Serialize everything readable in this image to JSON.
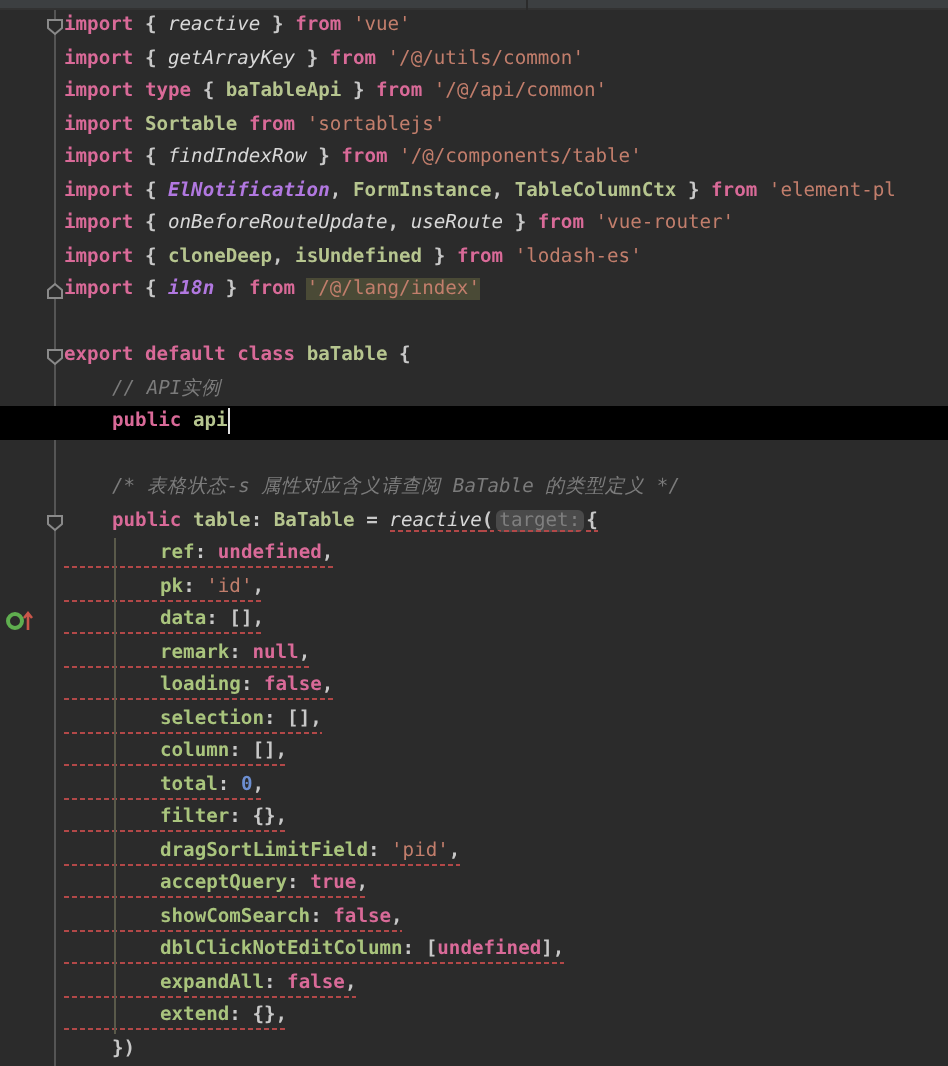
{
  "editor": {
    "lines": [
      {
        "kind": "code",
        "fold_start": true,
        "tokens": [
          {
            "text": "import",
            "kind": "keyword"
          },
          {
            "text": "{",
            "kind": "punct"
          },
          {
            "text": "reactive",
            "kind": "func"
          },
          {
            "text": "}",
            "kind": "punct"
          },
          {
            "text": "from",
            "kind": "keyword"
          },
          {
            "text": "'vue'",
            "kind": "string"
          }
        ]
      },
      {
        "kind": "code",
        "tokens": [
          {
            "text": "import",
            "kind": "keyword"
          },
          {
            "text": "{",
            "kind": "punct"
          },
          {
            "text": "getArrayKey",
            "kind": "func"
          },
          {
            "text": "}",
            "kind": "punct"
          },
          {
            "text": "from",
            "kind": "keyword"
          },
          {
            "text": "'/@/utils/common'",
            "kind": "string"
          }
        ]
      },
      {
        "kind": "code",
        "tokens": [
          {
            "text": "import",
            "kind": "keyword"
          },
          {
            "text": "type",
            "kind": "keyword"
          },
          {
            "text": "{",
            "kind": "punct"
          },
          {
            "text": "baTableApi",
            "kind": "ident"
          },
          {
            "text": "}",
            "kind": "punct"
          },
          {
            "text": "from",
            "kind": "keyword"
          },
          {
            "text": "'/@/api/common'",
            "kind": "string"
          }
        ]
      },
      {
        "kind": "code",
        "tokens": [
          {
            "text": "import",
            "kind": "keyword"
          },
          {
            "text": "Sortable",
            "kind": "ident"
          },
          {
            "text": "from",
            "kind": "keyword"
          },
          {
            "text": "'sortablejs'",
            "kind": "string"
          }
        ]
      },
      {
        "kind": "code",
        "tokens": [
          {
            "text": "import",
            "kind": "keyword"
          },
          {
            "text": "{",
            "kind": "punct"
          },
          {
            "text": "findIndexRow",
            "kind": "func"
          },
          {
            "text": "}",
            "kind": "punct"
          },
          {
            "text": "from",
            "kind": "keyword"
          },
          {
            "text": "'/@/components/table'",
            "kind": "string"
          }
        ]
      },
      {
        "kind": "code",
        "tokens": [
          {
            "text": "import",
            "kind": "keyword"
          },
          {
            "text": "{",
            "kind": "punct"
          },
          {
            "text": "ElNotification",
            "kind": "special"
          },
          {
            "text": ",",
            "kind": "punct",
            "tight": true
          },
          {
            "text": "FormInstance",
            "kind": "ident"
          },
          {
            "text": ",",
            "kind": "punct",
            "tight": true
          },
          {
            "text": "TableColumnCtx",
            "kind": "ident"
          },
          {
            "text": "}",
            "kind": "punct"
          },
          {
            "text": "from",
            "kind": "keyword"
          },
          {
            "text": "'element-pl",
            "kind": "string"
          }
        ]
      },
      {
        "kind": "code",
        "tokens": [
          {
            "text": "import",
            "kind": "keyword"
          },
          {
            "text": "{",
            "kind": "punct"
          },
          {
            "text": "onBeforeRouteUpdate",
            "kind": "func"
          },
          {
            "text": ",",
            "kind": "punct",
            "tight": true
          },
          {
            "text": "useRoute",
            "kind": "func"
          },
          {
            "text": "}",
            "kind": "punct"
          },
          {
            "text": "from",
            "kind": "keyword"
          },
          {
            "text": "'vue-router'",
            "kind": "string"
          }
        ]
      },
      {
        "kind": "code",
        "tokens": [
          {
            "text": "import",
            "kind": "keyword"
          },
          {
            "text": "{",
            "kind": "punct"
          },
          {
            "text": "cloneDeep",
            "kind": "ident"
          },
          {
            "text": ",",
            "kind": "punct",
            "tight": true
          },
          {
            "text": "isUndefined",
            "kind": "ident"
          },
          {
            "text": "}",
            "kind": "punct"
          },
          {
            "text": "from",
            "kind": "keyword"
          },
          {
            "text": "'lodash-es'",
            "kind": "string"
          }
        ]
      },
      {
        "kind": "code",
        "fold_end": true,
        "tokens": [
          {
            "text": "import",
            "kind": "keyword"
          },
          {
            "text": "{",
            "kind": "punct"
          },
          {
            "text": "i18n",
            "kind": "special"
          },
          {
            "text": "}",
            "kind": "punct"
          },
          {
            "text": "from",
            "kind": "keyword"
          },
          {
            "text": "'/@/lang/index'",
            "kind": "string_match"
          }
        ]
      },
      {
        "kind": "blank"
      },
      {
        "kind": "code",
        "fold_start": true,
        "tokens": [
          {
            "text": "export",
            "kind": "keyword"
          },
          {
            "text": "default",
            "kind": "keyword"
          },
          {
            "text": "class",
            "kind": "keyword"
          },
          {
            "text": "baTable",
            "kind": "ident"
          },
          {
            "text": "{",
            "kind": "punct"
          }
        ],
        "children": [
          {
            "kind": "code",
            "tokens": [
              {
                "text": "// API实例",
                "kind": "comment"
              }
            ]
          },
          {
            "kind": "code",
            "current": true,
            "tokens": [
              {
                "text": "public",
                "kind": "keyword"
              },
              {
                "text": "api",
                "kind": "ident"
              }
            ]
          },
          {
            "kind": "blank"
          },
          {
            "kind": "code",
            "tokens": [
              {
                "text": "/* 表格状态-s 属性对应含义请查阅 BaTable 的类型定义 */",
                "kind": "comment"
              }
            ]
          },
          {
            "kind": "code",
            "fold_start": true,
            "tokens": [
              {
                "text": "public",
                "kind": "keyword"
              },
              {
                "text": "table",
                "kind": "ident"
              },
              {
                "text": ":",
                "kind": "punct",
                "tight": true
              },
              {
                "text": "BaTable",
                "kind": "ident"
              },
              {
                "text": "=",
                "kind": "punct"
              },
              {
                "text": "reactive",
                "kind": "func",
                "warning": true
              },
              {
                "text": "(",
                "kind": "punct",
                "tight": true,
                "warning": true
              },
              {
                "text": "target:",
                "kind": "hint",
                "tight": true,
                "warning": true
              },
              {
                "text": "{",
                "kind": "punct",
                "tight": true,
                "warning": true
              }
            ],
            "children": [
              {
                "kind": "code",
                "warning": true,
                "tokens": [
                  {
                    "text": "ref",
                    "kind": "prop"
                  },
                  {
                    "text": ":",
                    "kind": "punct",
                    "tight": true
                  },
                  {
                    "text": "undefined",
                    "kind": "literal"
                  },
                  {
                    "text": ",",
                    "kind": "punct",
                    "tight": true
                  }
                ]
              },
              {
                "kind": "code",
                "warning": true,
                "tokens": [
                  {
                    "text": "pk",
                    "kind": "prop"
                  },
                  {
                    "text": ":",
                    "kind": "punct",
                    "tight": true
                  },
                  {
                    "text": "'id'",
                    "kind": "string"
                  },
                  {
                    "text": ",",
                    "kind": "punct",
                    "tight": true
                  }
                ]
              },
              {
                "kind": "code",
                "warning": true,
                "implemented": true,
                "tokens": [
                  {
                    "text": "data",
                    "kind": "prop"
                  },
                  {
                    "text": ":",
                    "kind": "punct",
                    "tight": true
                  },
                  {
                    "text": "[],",
                    "kind": "punct"
                  }
                ]
              },
              {
                "kind": "code",
                "warning": true,
                "tokens": [
                  {
                    "text": "remark",
                    "kind": "prop"
                  },
                  {
                    "text": ":",
                    "kind": "punct",
                    "tight": true
                  },
                  {
                    "text": "null",
                    "kind": "literal"
                  },
                  {
                    "text": ",",
                    "kind": "punct",
                    "tight": true
                  }
                ]
              },
              {
                "kind": "code",
                "warning": true,
                "tokens": [
                  {
                    "text": "loading",
                    "kind": "prop"
                  },
                  {
                    "text": ":",
                    "kind": "punct",
                    "tight": true
                  },
                  {
                    "text": "false",
                    "kind": "literal"
                  },
                  {
                    "text": ",",
                    "kind": "punct",
                    "tight": true
                  }
                ]
              },
              {
                "kind": "code",
                "warning": true,
                "tokens": [
                  {
                    "text": "selection",
                    "kind": "prop"
                  },
                  {
                    "text": ":",
                    "kind": "punct",
                    "tight": true
                  },
                  {
                    "text": "[],",
                    "kind": "punct"
                  }
                ]
              },
              {
                "kind": "code",
                "warning": true,
                "tokens": [
                  {
                    "text": "column",
                    "kind": "prop"
                  },
                  {
                    "text": ":",
                    "kind": "punct",
                    "tight": true
                  },
                  {
                    "text": "[],",
                    "kind": "punct"
                  }
                ]
              },
              {
                "kind": "code",
                "warning": true,
                "tokens": [
                  {
                    "text": "total",
                    "kind": "prop"
                  },
                  {
                    "text": ":",
                    "kind": "punct",
                    "tight": true
                  },
                  {
                    "text": "0",
                    "kind": "number"
                  },
                  {
                    "text": ",",
                    "kind": "punct",
                    "tight": true
                  }
                ]
              },
              {
                "kind": "code",
                "warning": true,
                "tokens": [
                  {
                    "text": "filter",
                    "kind": "prop"
                  },
                  {
                    "text": ":",
                    "kind": "punct",
                    "tight": true
                  },
                  {
                    "text": "{},",
                    "kind": "punct"
                  }
                ]
              },
              {
                "kind": "code",
                "warning": true,
                "tokens": [
                  {
                    "text": "dragSortLimitField",
                    "kind": "prop"
                  },
                  {
                    "text": ":",
                    "kind": "punct",
                    "tight": true
                  },
                  {
                    "text": "'pid'",
                    "kind": "string"
                  },
                  {
                    "text": ",",
                    "kind": "punct",
                    "tight": true
                  }
                ]
              },
              {
                "kind": "code",
                "warning": true,
                "tokens": [
                  {
                    "text": "acceptQuery",
                    "kind": "prop"
                  },
                  {
                    "text": ":",
                    "kind": "punct",
                    "tight": true
                  },
                  {
                    "text": "true",
                    "kind": "literal"
                  },
                  {
                    "text": ",",
                    "kind": "punct",
                    "tight": true
                  }
                ]
              },
              {
                "kind": "code",
                "warning": true,
                "tokens": [
                  {
                    "text": "showComSearch",
                    "kind": "prop"
                  },
                  {
                    "text": ":",
                    "kind": "punct",
                    "tight": true
                  },
                  {
                    "text": "false",
                    "kind": "literal"
                  },
                  {
                    "text": ",",
                    "kind": "punct",
                    "tight": true
                  }
                ]
              },
              {
                "kind": "code",
                "warning": true,
                "tokens": [
                  {
                    "text": "dblClickNotEditColumn",
                    "kind": "prop"
                  },
                  {
                    "text": ":",
                    "kind": "punct",
                    "tight": true
                  },
                  {
                    "text": "[",
                    "kind": "punct"
                  },
                  {
                    "text": "undefined",
                    "kind": "literal",
                    "tight": true
                  },
                  {
                    "text": "],",
                    "kind": "punct",
                    "tight": true
                  }
                ]
              },
              {
                "kind": "code",
                "warning": true,
                "tokens": [
                  {
                    "text": "expandAll",
                    "kind": "prop"
                  },
                  {
                    "text": ":",
                    "kind": "punct",
                    "tight": true
                  },
                  {
                    "text": "false",
                    "kind": "literal"
                  },
                  {
                    "text": ",",
                    "kind": "punct",
                    "tight": true
                  }
                ]
              },
              {
                "kind": "code",
                "warning": true,
                "tokens": [
                  {
                    "text": "extend",
                    "kind": "prop"
                  },
                  {
                    "text": ":",
                    "kind": "punct",
                    "tight": true
                  },
                  {
                    "text": "{},",
                    "kind": "punct"
                  }
                ]
              }
            ]
          },
          {
            "kind": "code",
            "tokens": [
              {
                "text": "})",
                "kind": "punct"
              }
            ]
          }
        ]
      }
    ]
  }
}
